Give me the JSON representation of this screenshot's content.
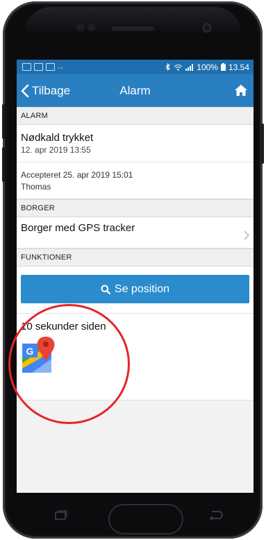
{
  "statusbar": {
    "battery": "100%",
    "time": "13.54"
  },
  "appbar": {
    "back_label": "Tilbage",
    "title": "Alarm"
  },
  "alarm": {
    "section_title": "ALARM",
    "event_title": "Nødkald trykket",
    "event_time": "12. apr 2019 13:55",
    "accepted_line": "Accepteret 25. apr 2019 15:01",
    "accepted_by": "Thomas"
  },
  "borger": {
    "section_title": "BORGER",
    "name": "Borger med GPS tracker"
  },
  "funktioner": {
    "section_title": "FUNKTIONER",
    "button_label": "Se position",
    "position_time": "10 sekunder siden"
  },
  "colors": {
    "appbar": "#2a7fc1",
    "statusbar": "#1f6faf",
    "button": "#2a8ccc",
    "annotation": "#e32629"
  }
}
